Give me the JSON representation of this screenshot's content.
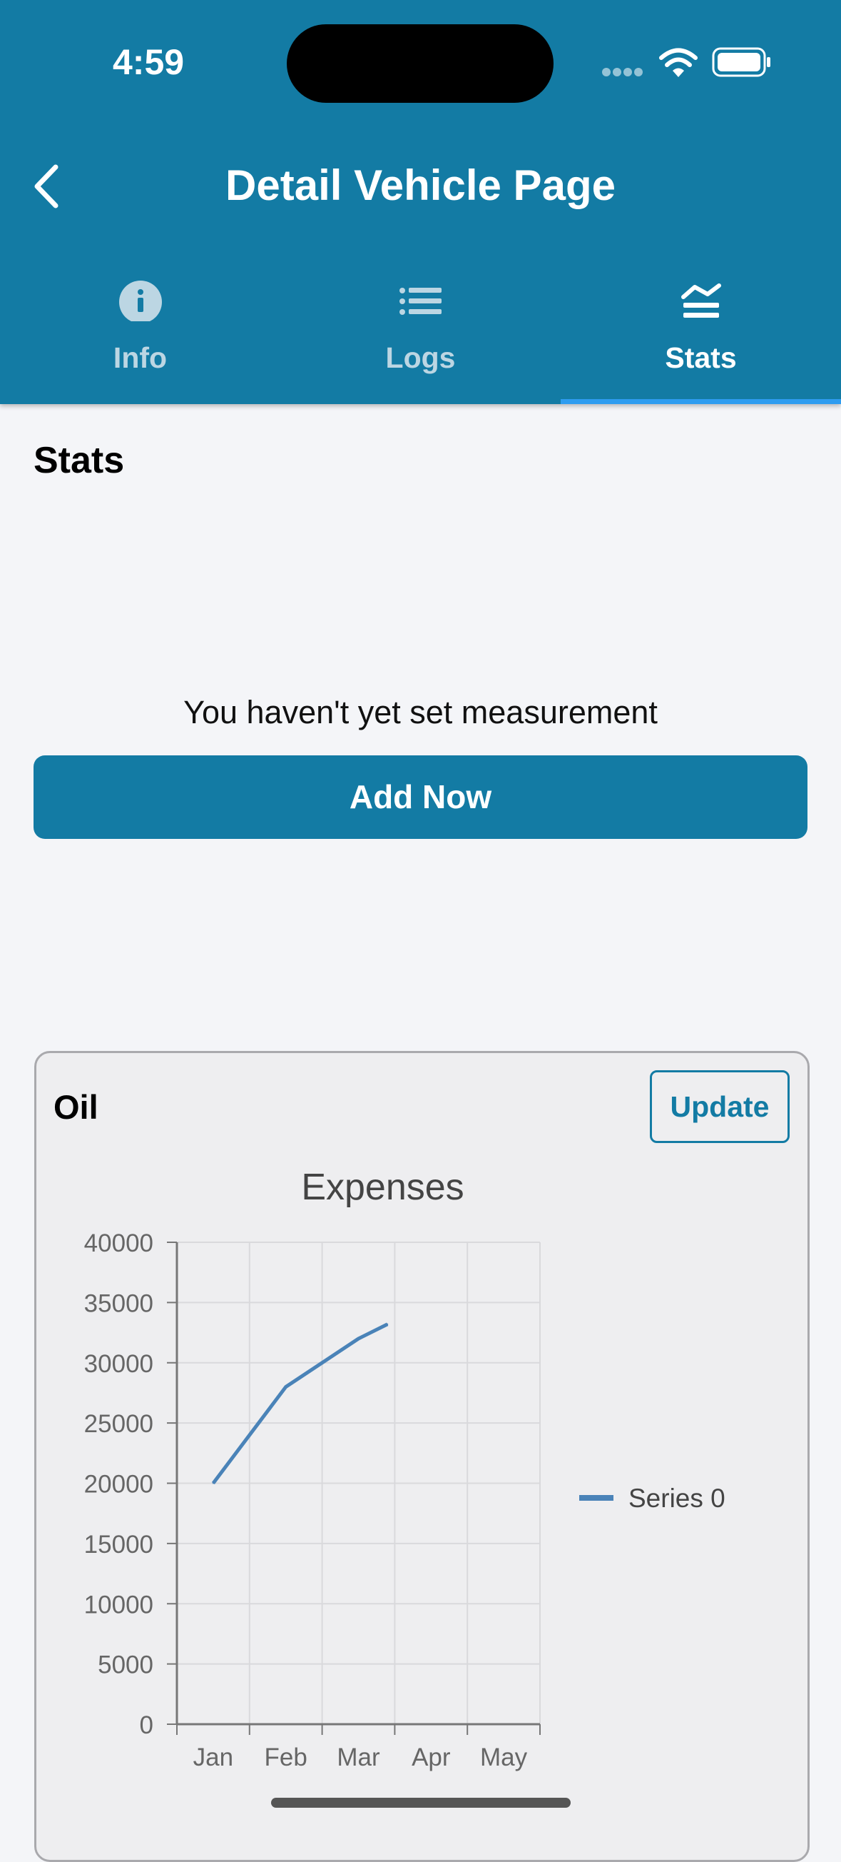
{
  "status": {
    "time": "4:59"
  },
  "header": {
    "title": "Detail Vehicle Page"
  },
  "tabs": [
    {
      "label": "Info",
      "icon": "info-icon"
    },
    {
      "label": "Logs",
      "icon": "list-icon"
    },
    {
      "label": "Stats",
      "icon": "stats-icon",
      "active": true
    }
  ],
  "stats": {
    "section_title": "Stats",
    "empty_message": "You haven't yet set measurement",
    "add_button": "Add Now"
  },
  "card": {
    "title": "Oil",
    "update_button": "Update"
  },
  "colors": {
    "primary": "#137ba4",
    "accent": "#2e9cf0",
    "series": "#4a83b8"
  },
  "chart_data": {
    "type": "line",
    "title": "Expenses",
    "categories": [
      "Jan",
      "Feb",
      "Mar",
      "Apr",
      "May"
    ],
    "x": [
      1,
      2,
      2.5,
      3,
      3.4
    ],
    "series": [
      {
        "name": "Series 0",
        "values": [
          20000,
          28000,
          30000,
          32000,
          33200
        ]
      }
    ],
    "yticks": [
      "0",
      "5000",
      "10000",
      "15000",
      "20000",
      "25000",
      "30000",
      "35000",
      "40000"
    ],
    "ylim": [
      0,
      40000
    ],
    "grid": true,
    "legend": "right"
  }
}
